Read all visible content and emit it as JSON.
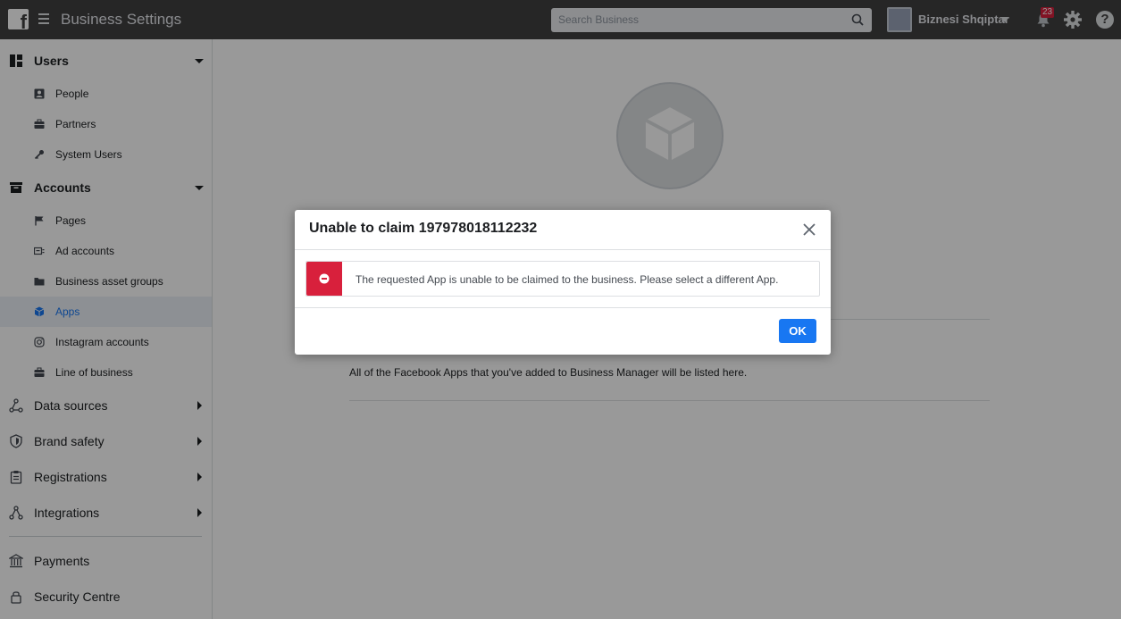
{
  "header": {
    "title": "Business Settings",
    "search_placeholder": "Search Business",
    "business_name": "Biznesi Shqiptar",
    "notification_count": "23",
    "help_glyph": "?"
  },
  "sidebar": {
    "users": {
      "label": "Users",
      "items": [
        {
          "label": "People",
          "icon": "person-badge-icon"
        },
        {
          "label": "Partners",
          "icon": "briefcase-icon"
        },
        {
          "label": "System Users",
          "icon": "key-icon"
        }
      ]
    },
    "accounts": {
      "label": "Accounts",
      "items": [
        {
          "label": "Pages",
          "icon": "flag-icon"
        },
        {
          "label": "Ad accounts",
          "icon": "ad-account-icon"
        },
        {
          "label": "Business asset groups",
          "icon": "folder-icon"
        },
        {
          "label": "Apps",
          "icon": "cube-icon",
          "active": true
        },
        {
          "label": "Instagram accounts",
          "icon": "instagram-icon"
        },
        {
          "label": "Line of business",
          "icon": "briefcase-icon"
        }
      ]
    },
    "collapsed_sections": [
      {
        "label": "Data sources",
        "icon": "data-sources-icon"
      },
      {
        "label": "Brand safety",
        "icon": "shield-icon"
      },
      {
        "label": "Registrations",
        "icon": "clipboard-icon"
      },
      {
        "label": "Integrations",
        "icon": "integrations-icon"
      }
    ],
    "bottom_items": [
      {
        "label": "Payments",
        "icon": "bank-icon"
      },
      {
        "label": "Security Centre",
        "icon": "lock-icon"
      }
    ]
  },
  "main": {
    "empty_description": "All of the Facebook Apps that you've added to Business Manager will be listed here."
  },
  "dialog": {
    "title": "Unable to claim 197978018112232",
    "message": "The requested App is unable to be claimed to the business. Please select a different App.",
    "ok_label": "OK"
  },
  "colors": {
    "topbar": "#404040",
    "accent": "#1877f2",
    "error": "#d8203c"
  }
}
